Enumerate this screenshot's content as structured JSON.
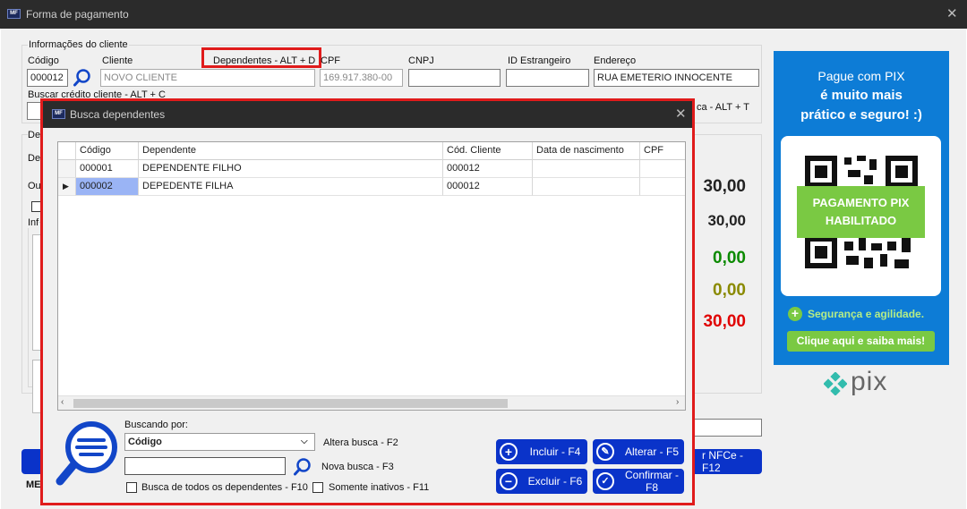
{
  "main_window": {
    "title": "Forma de pagamento",
    "close_symbol": "✕"
  },
  "client_info": {
    "group_label": "Informações do cliente",
    "codigo_label": "Código",
    "codigo_value": "000012",
    "cliente_label": "Cliente",
    "cliente_value": "NOVO CLIENTE",
    "dependentes_label": "Dependentes - ALT + D",
    "cpf_label": "CPF",
    "cpf_value": "169.917.380-00",
    "cnpj_label": "CNPJ",
    "cnpj_value": "",
    "id_estrangeiro_label": "ID Estrangeiro",
    "id_estrangeiro_value": "",
    "endereco_label": "Endereço",
    "endereco_value": "RUA EMETERIO INNOCENTE",
    "buscar_credito_label": "Buscar crédito cliente - ALT + C",
    "partial_shortcut": "ca - ALT + T"
  },
  "partial_labels": {
    "de_group": "De",
    "de_row": "De",
    "ou_row": "Ou",
    "inf_group": "Inf",
    "me_label": "ME"
  },
  "totals": {
    "v1": "30,00",
    "v2": "30,00",
    "v3": "0,00",
    "v4": "0,00",
    "v5": "30,00",
    "colors": {
      "v1": "#000000",
      "v2": "#000000",
      "v3": "#0b8a00",
      "v4": "#8a8a00",
      "v5": "#e00000"
    }
  },
  "nfce_button_label": "r NFCe - F12",
  "pix_ad": {
    "line1": "Pague com PIX",
    "line2": "é muito mais",
    "line3": "prático e seguro! :)",
    "badge_line1": "PAGAMENTO PIX",
    "badge_line2": "HABILITADO",
    "security_text": "Segurança e agilidade.",
    "cta": "Clique aqui e saiba mais!",
    "logo_text": "pix",
    "brand_color": "#0d7cd6",
    "accent_color": "#7ac943"
  },
  "dialog": {
    "title": "Busca dependentes",
    "close_symbol": "✕",
    "columns": [
      "Código",
      "Dependente",
      "Cód. Cliente",
      "Data de nascimento",
      "CPF"
    ],
    "rows": [
      {
        "codigo": "000001",
        "dependente": "DEPENDENTE FILHO",
        "cod_cliente": "000012",
        "nascimento": "",
        "cpf": ""
      },
      {
        "codigo": "000002",
        "dependente": "DEPEDENTE FILHA",
        "cod_cliente": "000012",
        "nascimento": "",
        "cpf": ""
      }
    ],
    "selected_row_index": 1,
    "buscando_por_label": "Buscando por:",
    "buscando_por_value": "Código",
    "search_value": "",
    "altera_busca": "Altera busca - F2",
    "nova_busca": "Nova busca - F3",
    "busca_todos": "Busca de todos os dependentes - F10",
    "somente_inativos": "Somente inativos - F11",
    "buttons": {
      "incluir": "Incluir - F4",
      "alterar": "Alterar - F5",
      "excluir": "Excluir - F6",
      "confirmar": "Confirmar - F8"
    }
  },
  "highlight_color": "#e01b1b"
}
